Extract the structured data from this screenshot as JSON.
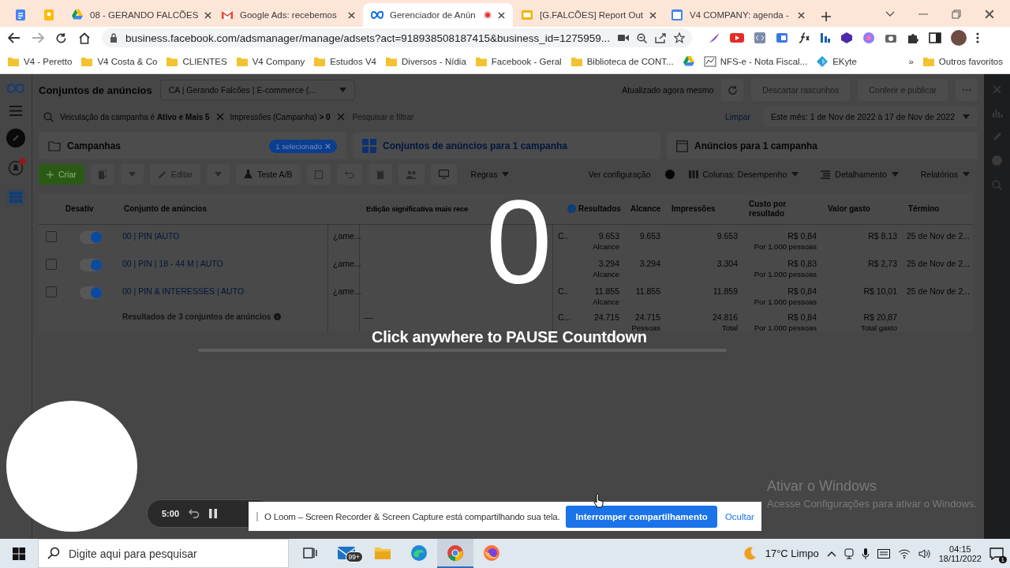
{
  "browser": {
    "tabs": [
      {
        "kind": "docs",
        "selected": false,
        "recording": false
      },
      {
        "kind": "keep",
        "selected": false,
        "recording": false
      },
      {
        "kind": "drive",
        "title": "08 - GERANDO FALCÕES",
        "selected": false,
        "recording": false
      },
      {
        "kind": "gmail",
        "title": "Google Ads: recebemos",
        "selected": false,
        "recording": false
      },
      {
        "kind": "meta",
        "title": "Gerenciador de Anún",
        "selected": true,
        "recording": true
      },
      {
        "kind": "slides",
        "title": "[G.FALCÕES] Report Out",
        "selected": false,
        "recording": false
      },
      {
        "kind": "calendar",
        "title": "V4 COMPANY: agenda -",
        "selected": false,
        "recording": false
      }
    ],
    "address": "business.facebook.com/adsmanager/manage/adsets?act=918938508187415&business_id=1275959...",
    "bookmarks": [
      {
        "kind": "folder",
        "label": "V4 - Peretto"
      },
      {
        "kind": "folder",
        "label": "V4 Costa & Co"
      },
      {
        "kind": "folder",
        "label": "CLIENTES"
      },
      {
        "kind": "folder",
        "label": "V4 Company"
      },
      {
        "kind": "folder",
        "label": "Estudos V4"
      },
      {
        "kind": "folder",
        "label": "Diversos - Nídia"
      },
      {
        "kind": "folder",
        "label": "Facebook - Geral"
      },
      {
        "kind": "folder",
        "label": "Biblioteca de CONT..."
      },
      {
        "kind": "drive"
      },
      {
        "kind": "document",
        "label": "NFS-e - Nota Fiscal..."
      },
      {
        "kind": "ekyte",
        "label": "EKyte"
      }
    ],
    "more_bookmarks": "»",
    "other_bookmarks": "Outros favoritos"
  },
  "ads_manager": {
    "title": "Conjuntos de anúncios",
    "account": "CA | Gerando Falcões | E-commerce (...",
    "status": "Atualizado agora mesmo",
    "publish_buttons": [
      {
        "label": "Descartar rascunhos",
        "disabled": true
      },
      {
        "label": "Conferir e publicar",
        "disabled": true
      }
    ],
    "filters": [
      {
        "text": "Veiculação da campanha é **Ativo e Mais 5**"
      },
      {
        "text": "Impressões (Campanha) **> 0**"
      }
    ],
    "search_placeholder": "Pesquisar e filtrar",
    "clear": "Limpar",
    "date_range": "Este mês: 1 de Nov de 2022 à 17 de Nov de 2022",
    "level_tabs": [
      {
        "label": "Campanhas",
        "selected": false,
        "badge": "1 selecionado"
      },
      {
        "label": "Conjuntos de anúncios para 1 campanha",
        "selected": true
      },
      {
        "label": "Anúncios para 1 campanha",
        "selected": false
      }
    ],
    "toolbar": {
      "create": "Criar",
      "edit": {
        "label": "Editar",
        "disabled": true
      },
      "ab_test": "Teste A/B",
      "rules": "Regras",
      "view_setup": {
        "label": "Ver configuração",
        "on": false
      },
      "columns": "Colunas: Desempenho",
      "breakdown": "Detalhamento",
      "reports": "Relatórios"
    },
    "table": {
      "columns": [
        "Desativ",
        "Conjunto de anúncios",
        "Edição significativa mais rece",
        "Resultados",
        "Alcance",
        "Impressões",
        "Custo por resultado",
        "Valor gasto",
        "Término"
      ],
      "rows": [
        {
          "checked": false,
          "on": true,
          "name": "00 | PIN |AUTO",
          "column_3": "¿ame...",
          "column_5": "C..",
          "results": "9.653",
          "results_note": "Alcance",
          "reach": "9.653",
          "impressions": "9.653",
          "cost": "R$ 0,84",
          "cost_note": "Por 1.000 pessoas",
          "spent": "R$ 8,13",
          "end": "25 de Nov de 2..."
        },
        {
          "checked": false,
          "on": true,
          "name": "00 | PIN | 18 - 44 M | AUTO",
          "column_3": "¿ame...",
          "results": "3.294",
          "results_note": "Alcance",
          "reach": "3.294",
          "impressions": "3.304",
          "cost": "R$ 0,83",
          "cost_note": "Por 1.000 pessoas",
          "spent": "R$ 2,73",
          "end": "25 de Nov de 2..."
        },
        {
          "checked": false,
          "on": true,
          "name": "00 | PIN & INTERESSES | AUTO",
          "column_3": "¿ame...",
          "column_5": "C..",
          "results": "11.855",
          "results_note": "Alcance",
          "reach": "11.855",
          "impressions": "11.859",
          "cost": "R$ 0,84",
          "cost_note": "Por 1.000 pessoas",
          "spent": "R$ 10,01",
          "end": "25 de Nov de 2..."
        }
      ],
      "footer": {
        "label": "Resultados de 3 conjuntos de anúncios",
        "edit": "—",
        "column_5": "C...",
        "results": "24.715",
        "reach": "24.715",
        "reach_note": "Pessoas",
        "impressions": "24.816",
        "impressions_note": "Total",
        "cost": "R$ 0,84",
        "cost_note": "Por 1.000 pessoas",
        "spent": "R$ 20,87",
        "spent_note": "Total gasto"
      }
    }
  },
  "countdown": {
    "number": "0",
    "hint": "Click anywhere to PAUSE Countdown"
  },
  "loom": {
    "timer": "5:00",
    "message": "O Loom – Screen Recorder & Screen Capture está compartilhando sua tela.",
    "stop_button": "Interromper compartilhamento",
    "hide_link": "Ocultar"
  },
  "windows_activation": {
    "title": "Ativar o Windows",
    "message": "Acesse Configurações para ativar o Windows."
  },
  "taskbar": {
    "search_placeholder": "Digite aqui para pesquisar",
    "apps": [
      {
        "kind": "task-view",
        "selected": false
      },
      {
        "kind": "mail",
        "badge": "99+",
        "selected": false
      },
      {
        "kind": "explorer",
        "selected": false
      },
      {
        "kind": "edge",
        "selected": false
      },
      {
        "kind": "chrome",
        "selected": true
      },
      {
        "kind": "firefox",
        "selected": false
      }
    ],
    "weather": "17°C  Limpo",
    "time": "04:15",
    "date": "18/11/2022",
    "notifications": "1"
  }
}
